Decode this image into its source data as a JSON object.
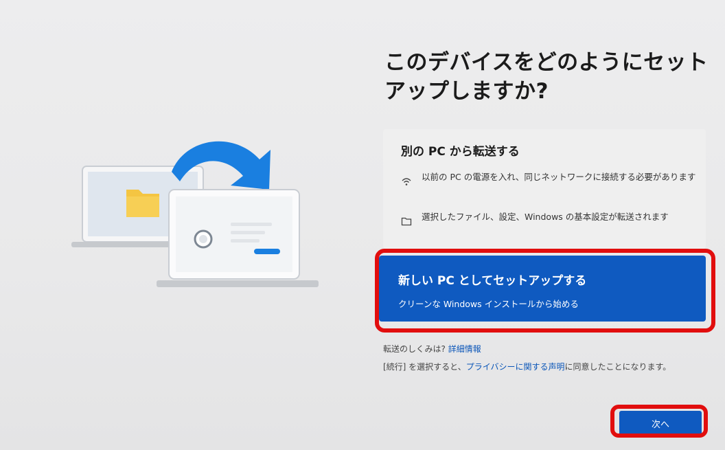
{
  "page": {
    "title": "このデバイスをどのようにセットアップしますか?"
  },
  "transfer_option": {
    "title": "別の PC から転送する",
    "bullets": [
      {
        "icon": "wifi-icon",
        "text": "以前の PC の電源を入れ、同じネットワークに接続する必要があります"
      },
      {
        "icon": "folder-outline-icon",
        "text": "選択したファイル、設定、Windows の基本設定が転送されます"
      }
    ]
  },
  "new_pc_option": {
    "title": "新しい PC としてセットアップする",
    "subtitle": "クリーンな Windows インストールから始める",
    "selected": true
  },
  "info": {
    "how_it_works_prefix": "転送のしくみは?",
    "how_it_works_link": "詳細情報",
    "privacy_prefix": "[続行] を選択すると、",
    "privacy_link": "プライバシーに関する声明",
    "privacy_suffix": "に同意したことになります。"
  },
  "buttons": {
    "next_label": "次へ"
  },
  "colors": {
    "accent": "#0f5ac0",
    "highlight": "#e10e0e",
    "background": "#ebebec"
  }
}
